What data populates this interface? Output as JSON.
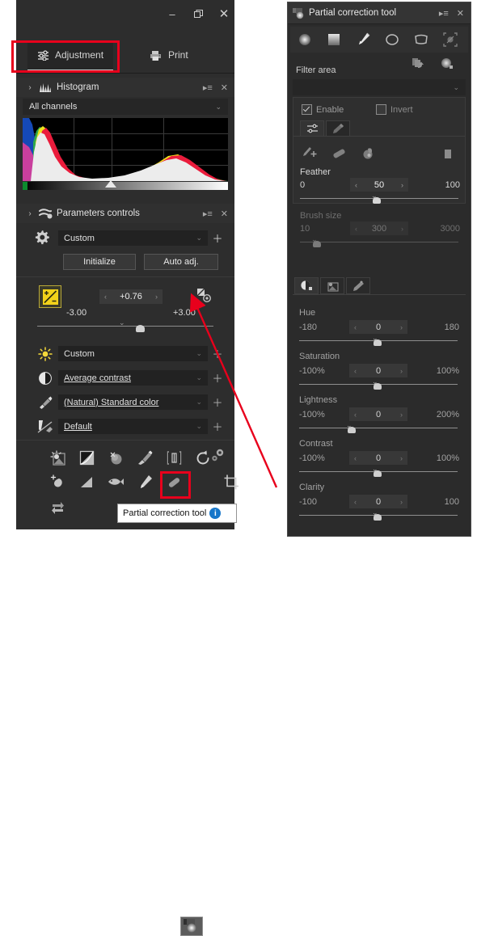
{
  "left_window": {
    "titlebar": {
      "minimize": "–",
      "maximize": "❐",
      "close": "✕"
    },
    "tabs": [
      {
        "label": "Adjustment",
        "icon": "sliders-icon",
        "active": true
      },
      {
        "label": "Print",
        "icon": "printer-icon",
        "active": false
      }
    ],
    "histogram_panel": {
      "title": "Histogram",
      "icon": "histogram-icon",
      "expand_arrow": "›",
      "menu_icon": "▸≡",
      "close_icon": "✕",
      "channel_select": {
        "value": "All channels",
        "chevron": "⌄"
      }
    },
    "parameters_panel": {
      "title": "Parameters controls",
      "icon": "parameters-icon",
      "expand_arrow": "›",
      "menu_icon": "▸≡",
      "close_icon": "✕",
      "preset": {
        "value": "Custom",
        "chevron": "⌄",
        "plus": "＋"
      },
      "buttons": {
        "initialize": "Initialize",
        "auto_adjust": "Auto adj."
      },
      "exposure": {
        "value": "+0.76",
        "min": "-3.00",
        "max": "+3.00",
        "left_arrow": "‹",
        "right_arrow": "›",
        "tick": "⌄",
        "icon": "exposure-icon",
        "reset_icon": "reset-exposure-icon"
      },
      "rows": [
        {
          "icon": "brightness-icon",
          "value": "Custom",
          "underline": false,
          "chevron": "⌄",
          "plus": "＋"
        },
        {
          "icon": "contrast-icon",
          "value": "Average contrast",
          "underline": true,
          "chevron": "⌄",
          "plus": "＋"
        },
        {
          "icon": "color-icon",
          "value": "(Natural) Standard color",
          "underline": true,
          "chevron": "⌄",
          "plus": "＋"
        },
        {
          "icon": "sharpness-icon",
          "value": "Default",
          "underline": true,
          "chevron": "⌄",
          "plus": "＋"
        }
      ]
    },
    "tool_grid": {
      "row1": [
        "brightness-tool-icon",
        "tone-curve-tool-icon",
        "dodge-burn-tool-icon",
        "color-tool-icon",
        "noise-tool-icon",
        "rotate-tool-icon",
        "settings-tool-icon"
      ],
      "row2": [
        "dust-tool-icon",
        "vignette-tool-icon",
        "fisheye-tool-icon",
        "retouch-brush-tool-icon",
        "healing-tool-icon",
        "partial-correction-tool-icon",
        "crop-tool-icon"
      ],
      "row3": [
        "resize-tool-icon"
      ],
      "selected": "partial-correction-tool-icon"
    },
    "tooltip": {
      "text": "Partial correction tool",
      "info_glyph": "i"
    }
  },
  "right_window": {
    "title": "Partial correction tool",
    "title_icon": "partial-correction-icon",
    "menu_icon": "▸≡",
    "close_icon": "✕",
    "shape_tools": [
      "gradient-radial-icon",
      "gradient-linear-icon",
      "brush-icon",
      "ellipse-icon",
      "polygon-icon",
      "auto-select-icon"
    ],
    "shape_selected_index": 2,
    "filter_area": {
      "label": "Filter area",
      "icon_copy": "copy-filter-icon",
      "icon_new": "new-filter-icon",
      "select_value": "",
      "chevron": "⌄"
    },
    "enable_checkbox": {
      "label": "Enable",
      "checked": true
    },
    "invert_checkbox": {
      "label": "Invert",
      "checked": false
    },
    "mini_tabs": [
      "adjust-tab-icon",
      "wand-tab-icon"
    ],
    "brush_icons": [
      "brush-add-icon",
      "eraser-icon",
      "fill-icon",
      "delete-icon"
    ],
    "sliders_area": [
      {
        "label": "Feather",
        "min": "0",
        "max": "100",
        "value": "50",
        "left_arrow": "‹",
        "right_arrow": "›",
        "knob_pct": 50,
        "enabled": true
      },
      {
        "label": "Brush size",
        "min": "10",
        "max": "3000",
        "value": "300",
        "left_arrow": "‹",
        "right_arrow": "›",
        "knob_pct": 10,
        "enabled": false
      }
    ],
    "adjust_tabs": [
      "hsl-tab-icon",
      "tone-tab-icon",
      "effects-tab-icon"
    ],
    "adjust_sliders": [
      {
        "label": "Hue",
        "min": "-180",
        "max": "180",
        "value": "0",
        "left_arrow": "‹",
        "right_arrow": "›",
        "knob_pct": 50
      },
      {
        "label": "Saturation",
        "min": "-100%",
        "max": "100%",
        "value": "0",
        "left_arrow": "‹",
        "right_arrow": "›",
        "knob_pct": 50
      },
      {
        "label": "Lightness",
        "min": "-100%",
        "max": "200%",
        "value": "0",
        "left_arrow": "‹",
        "right_arrow": "›",
        "knob_pct": 33
      },
      {
        "label": "Contrast",
        "min": "-100%",
        "max": "100%",
        "value": "0",
        "left_arrow": "‹",
        "right_arrow": "›",
        "knob_pct": 50
      },
      {
        "label": "Clarity",
        "min": "-100",
        "max": "100",
        "value": "0",
        "left_arrow": "‹",
        "right_arrow": "›",
        "knob_pct": 50
      }
    ]
  },
  "annotations": {
    "highlight_color": "#e8001c",
    "callout_arrow": "red-arrow-pointer"
  }
}
